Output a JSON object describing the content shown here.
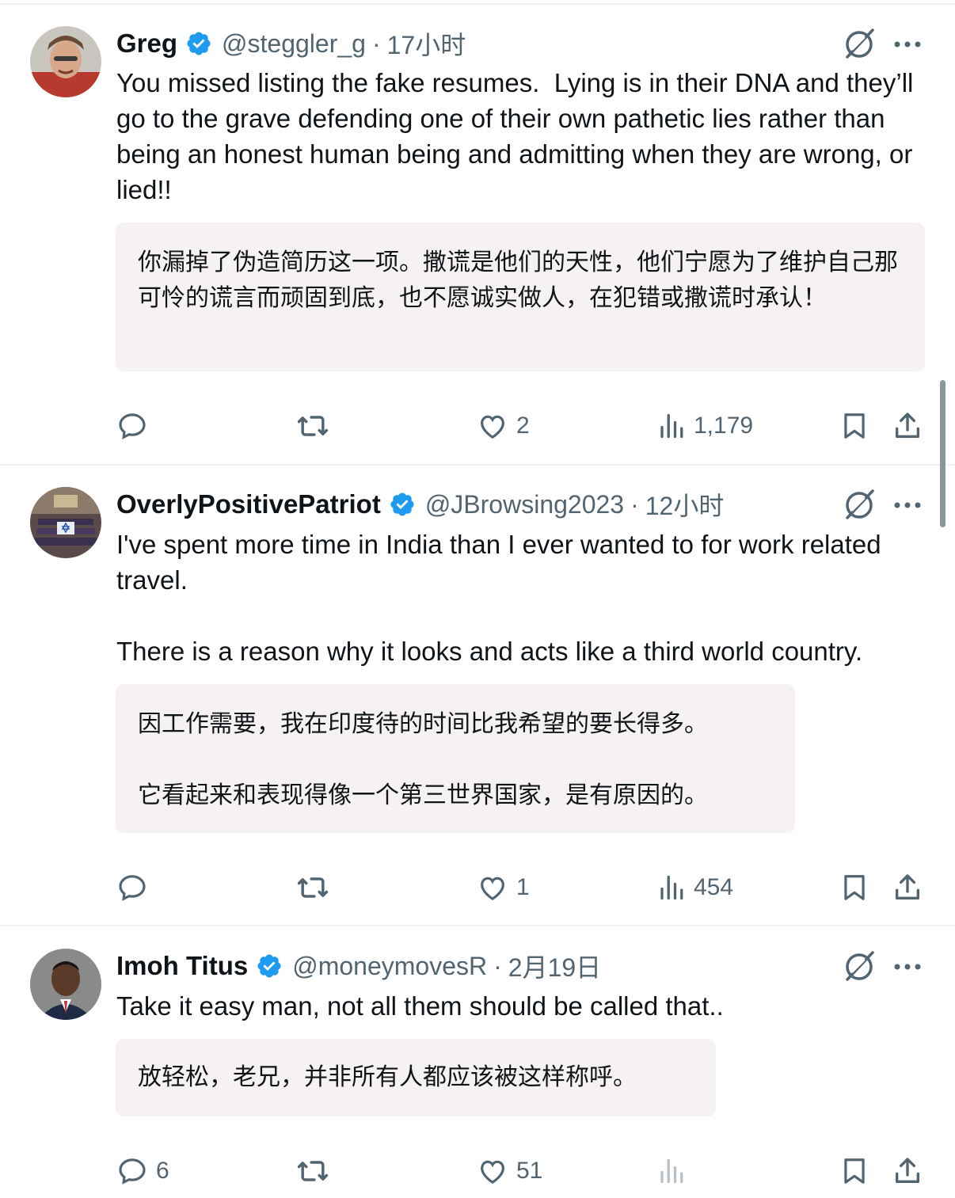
{
  "tweets": [
    {
      "name": "Greg",
      "handle": "@steggler_g",
      "separator": "·",
      "time": "17小时",
      "text": "You missed listing the fake resumes.  Lying is in their DNA and they’ll  go to the grave defending one of their own pathetic lies rather than being an honest human being and admitting when they are wrong, or lied!!",
      "translation": "你漏掉了伪造简历这一项。撒谎是他们的天性，他们宁愿为了维护自己那可怜的谎言而顽固到底，也不愿诚实做人，在犯错或撒谎时承认！",
      "replies": "",
      "likes": "2",
      "views": "1,179"
    },
    {
      "name": "OverlyPositivePatriot",
      "handle": "@JBrowsing2023",
      "separator": "·",
      "time": "12小时",
      "text": "I've spent more time in India than I ever wanted to for work related travel.\n\nThere is a reason why it looks and acts like a third world country.",
      "translation": "因工作需要，我在印度待的时间比我希望的要长得多。\n\n它看起来和表现得像一个第三世界国家，是有原因的。",
      "replies": "",
      "likes": "1",
      "views": "454"
    },
    {
      "name": "Imoh Titus",
      "handle": "@moneymovesR",
      "separator": "·",
      "time": "2月19日",
      "text": "Take it easy man, not all them should be called that..",
      "translation": "放轻松，老兄，并非所有人都应该被这样称呼。",
      "replies": "6",
      "likes": "51",
      "views": ""
    }
  ],
  "colors": {
    "verified": "#1d9bf0",
    "icon": "#536471",
    "translation_bg": "#f7f2f2"
  },
  "icons": [
    "verified-badge",
    "grok-icon",
    "more-icon",
    "reply-icon",
    "repost-icon",
    "like-icon",
    "views-icon",
    "bookmark-icon",
    "share-icon"
  ]
}
